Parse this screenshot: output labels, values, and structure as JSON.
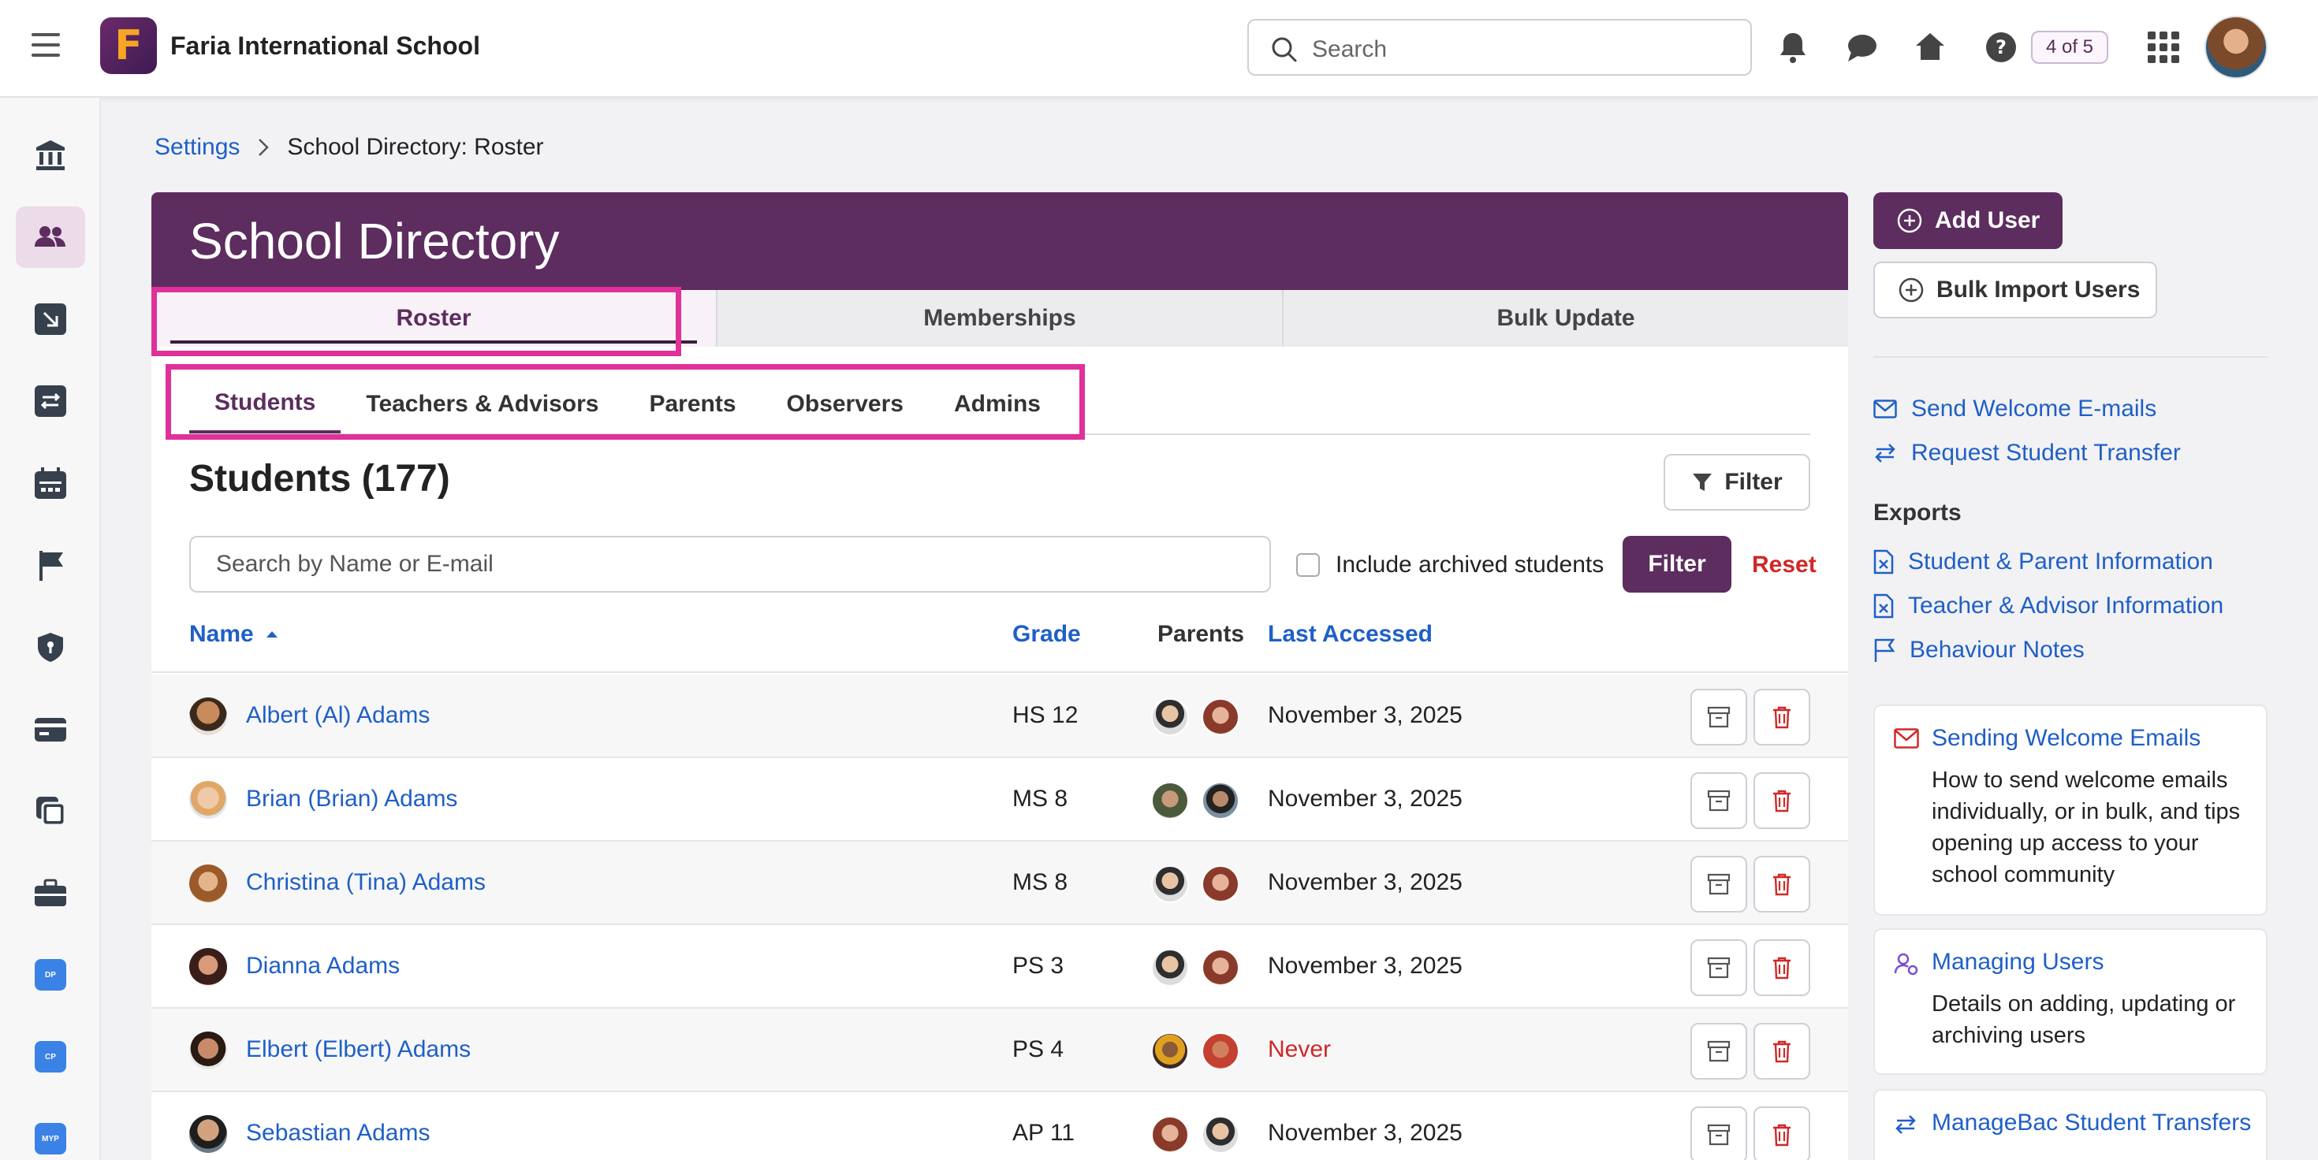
{
  "header": {
    "logo_letter": "F",
    "school_name": "Faria International School",
    "search_placeholder": "Search",
    "pager": "4 of 5"
  },
  "breadcrumb": {
    "parent": "Settings",
    "current": "School Directory: Roster"
  },
  "directory": {
    "title": "School Directory",
    "tabs": [
      "Roster",
      "Memberships",
      "Bulk Update"
    ],
    "subtabs": [
      "Students",
      "Teachers & Advisors",
      "Parents",
      "Observers",
      "Admins"
    ],
    "heading": "Students (177)",
    "filter_button": "Filter",
    "search_placeholder": "Search by Name or E-mail",
    "include_archived": "Include archived students",
    "apply_button": "Filter",
    "reset_button": "Reset",
    "columns": {
      "name": "Name",
      "grade": "Grade",
      "parents": "Parents",
      "last_accessed": "Last Accessed"
    },
    "rows": [
      {
        "name": "Albert (Al) Adams",
        "grade": "HS 12",
        "last_accessed": "November 3, 2025"
      },
      {
        "name": "Brian (Brian) Adams",
        "grade": "MS 8",
        "last_accessed": "November 3, 2025"
      },
      {
        "name": "Christina (Tina) Adams",
        "grade": "MS 8",
        "last_accessed": "November 3, 2025"
      },
      {
        "name": "Dianna Adams",
        "grade": "PS 3",
        "last_accessed": "November 3, 2025"
      },
      {
        "name": "Elbert (Elbert) Adams",
        "grade": "PS 4",
        "last_accessed": "Never"
      },
      {
        "name": "Sebastian Adams",
        "grade": "AP 11",
        "last_accessed": "November 3, 2025"
      }
    ]
  },
  "sidebar_panel": {
    "add_user": "Add User",
    "bulk_import": "Bulk Import Users",
    "links": [
      "Send Welcome E-mails",
      "Request Student Transfer"
    ],
    "exports_title": "Exports",
    "exports": [
      "Student & Parent Information",
      "Teacher & Advisor Information",
      "Behaviour Notes"
    ],
    "help": [
      {
        "title": "Sending Welcome Emails",
        "desc": "How to send welcome emails individually, or in bulk, and tips opening up access to your school community"
      },
      {
        "title": "Managing Users",
        "desc": "Details on adding, updating or archiving users"
      },
      {
        "title": "ManageBac Student Transfers",
        "desc": ""
      }
    ]
  },
  "nav_apps": [
    "DP",
    "CP",
    "MYP"
  ],
  "colors": {
    "brand": "#5c2d5e",
    "link": "#1f5fc7",
    "danger": "#d02828",
    "highlight": "#e0309a"
  }
}
